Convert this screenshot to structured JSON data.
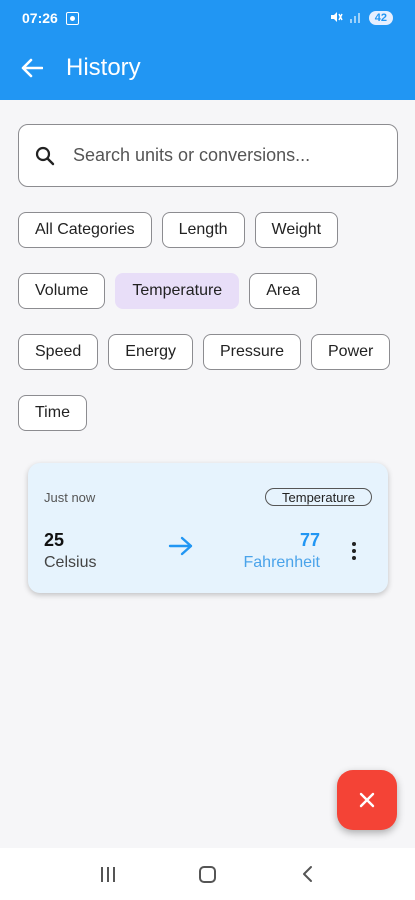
{
  "status_bar": {
    "time": "07:26",
    "battery": "42",
    "icons": [
      "screen-record-icon",
      "mute-icon",
      "signal-icon",
      "battery-icon"
    ]
  },
  "app_bar": {
    "title": "History",
    "back_icon": "arrow-left-icon"
  },
  "search": {
    "placeholder": "Search units or conversions...",
    "value": "",
    "icon": "search-icon"
  },
  "categories": {
    "selected": "Temperature",
    "items": [
      {
        "label": "All Categories"
      },
      {
        "label": "Length"
      },
      {
        "label": "Weight"
      },
      {
        "label": "Volume"
      },
      {
        "label": "Temperature"
      },
      {
        "label": "Area"
      },
      {
        "label": "Speed"
      },
      {
        "label": "Energy"
      },
      {
        "label": "Pressure"
      },
      {
        "label": "Power"
      },
      {
        "label": "Time"
      }
    ]
  },
  "history": [
    {
      "time": "Just now",
      "category": "Temperature",
      "from_value": "25",
      "from_unit": "Celsius",
      "to_value": "77",
      "to_unit": "Fahrenheit"
    }
  ],
  "fab": {
    "icon": "close-icon"
  },
  "navigation": {
    "icons": [
      "recents-icon",
      "home-icon",
      "back-icon"
    ]
  },
  "colors": {
    "primary": "#2196f3",
    "selected_chip": "#e8def8",
    "card_background": "#e6f3fd",
    "fab": "#f44336"
  }
}
